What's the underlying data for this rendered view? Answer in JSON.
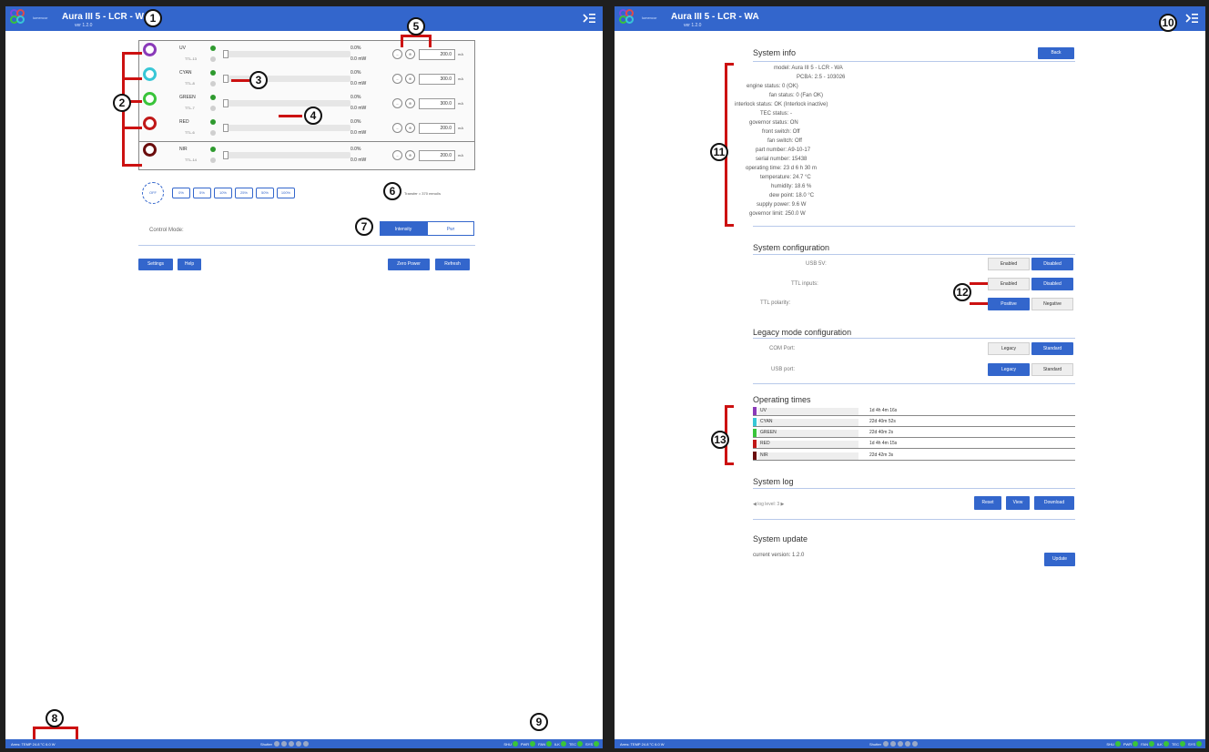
{
  "left": {
    "app_title": "Aura III 5 - LCR - WA",
    "version": "ver 1.2.0",
    "logo_text": "lumencor",
    "channels": [
      {
        "name": "UV",
        "ttl": "TTL-13",
        "pct": "0.0%",
        "power": "0.0 mW",
        "value": "200.0",
        "unit": "mA",
        "color": "#8a3ab9"
      },
      {
        "name": "CYAN",
        "ttl": "TTL-8",
        "pct": "0.0%",
        "power": "0.0 mW",
        "value": "300.0",
        "unit": "mA",
        "color": "#38c7d6"
      },
      {
        "name": "GREEN",
        "ttl": "TTL-7",
        "pct": "0.0%",
        "power": "0.0 mW",
        "value": "300.0",
        "unit": "mA",
        "color": "#39c43a"
      },
      {
        "name": "RED",
        "ttl": "TTL-6",
        "pct": "0.0%",
        "power": "0.0 mW",
        "value": "200.0",
        "unit": "mA",
        "color": "#c01818"
      },
      {
        "name": "NIR",
        "ttl": "TTL-14",
        "pct": "0.0%",
        "power": "0.0 mW",
        "value": "200.0",
        "unit": "mA",
        "color": "#6b0d0d"
      }
    ],
    "presets": [
      "0%",
      "5%",
      "10%",
      "25%",
      "50%",
      "100%"
    ],
    "power_label": "OFF",
    "transfer": "Transfer = 370 mmol/s",
    "control_mode_label": "Control Mode:",
    "control_modes": [
      "Intensity",
      "Pwr"
    ],
    "buttons": {
      "settings": "Settings",
      "help": "Help",
      "zero": "Zero Power",
      "refresh": "Refresh"
    },
    "status_left": "Arms: TEMP  24.8 °C   6.0 W",
    "status_mid_label": "Shutter",
    "status_right": [
      "SHU",
      "PWR",
      "FAN",
      "ILK",
      "TEC",
      "SYS"
    ],
    "callouts": [
      "1",
      "2",
      "3",
      "4",
      "5",
      "6",
      "7",
      "8",
      "9"
    ]
  },
  "right": {
    "app_title": "Aura III 5 - LCR - WA",
    "version": "ver 1.2.0",
    "logo_text": "lumencor",
    "system_info_title": "System info",
    "back_label": "Back",
    "info_lines": [
      "model: Aura III 5 - LCR - WA",
      "PCBA: 2.5 - 103026",
      "engine status: 0 (OK)",
      "fan status: 0 (Fan OK)",
      "interlock status: OK (Interlock inactive)",
      "TEC status: -",
      "governor status: ON",
      "front switch: Off",
      "fan switch: Off",
      "part number: A9-10-17",
      "serial number: 15438",
      "operating time: 23 d 6 h 30 m",
      "temperature: 24.7 °C",
      "humidity: 18.6 %",
      "dew point: 18.0 °C",
      "supply power: 9.6 W",
      "governor limit: 250.0 W"
    ],
    "sys_config_title": "System configuration",
    "sys_config": [
      {
        "label": "USB 5V:",
        "options": [
          "Enabled",
          "Disabled"
        ],
        "active": 1
      },
      {
        "label": "TTL inputs:",
        "options": [
          "Enabled",
          "Disabled"
        ],
        "active": 1
      },
      {
        "label": "TTL polarity:",
        "options": [
          "Positive",
          "Negative"
        ],
        "active": 0
      }
    ],
    "legacy_title": "Legacy mode configuration",
    "legacy_config": [
      {
        "label": "COM Port:",
        "options": [
          "Legacy",
          "Standard"
        ],
        "active": 1
      },
      {
        "label": "USB port:",
        "options": [
          "Legacy",
          "Standard"
        ],
        "active": 0
      }
    ],
    "op_times_title": "Operating times",
    "op_times": [
      {
        "name": "UV",
        "value": "1d 4h 4m 16s",
        "color": "#8a3ab9"
      },
      {
        "name": "CYAN",
        "value": "22d 40m 52s",
        "color": "#38c7d6"
      },
      {
        "name": "GREEN",
        "value": "22d 40m 2s",
        "color": "#39c43a"
      },
      {
        "name": "RED",
        "value": "1d 4h 4m 15s",
        "color": "#c01818"
      },
      {
        "name": "NIR",
        "value": "22d 42m 3s",
        "color": "#6b0d0d"
      }
    ],
    "sys_log_title": "System log",
    "log_level": "log level: 3",
    "log_buttons": [
      "Reset",
      "View",
      "Download"
    ],
    "sys_update_title": "System update",
    "current_version": "current version: 1.2.0",
    "update_label": "Update",
    "status_left": "Arms: TEMP  24.8 °C   6.0 W",
    "status_mid_label": "Shutter",
    "status_right": [
      "SHU",
      "PWR",
      "FAN",
      "ILK",
      "TEC",
      "SYS"
    ],
    "callouts": [
      "10",
      "11",
      "12",
      "13"
    ]
  }
}
